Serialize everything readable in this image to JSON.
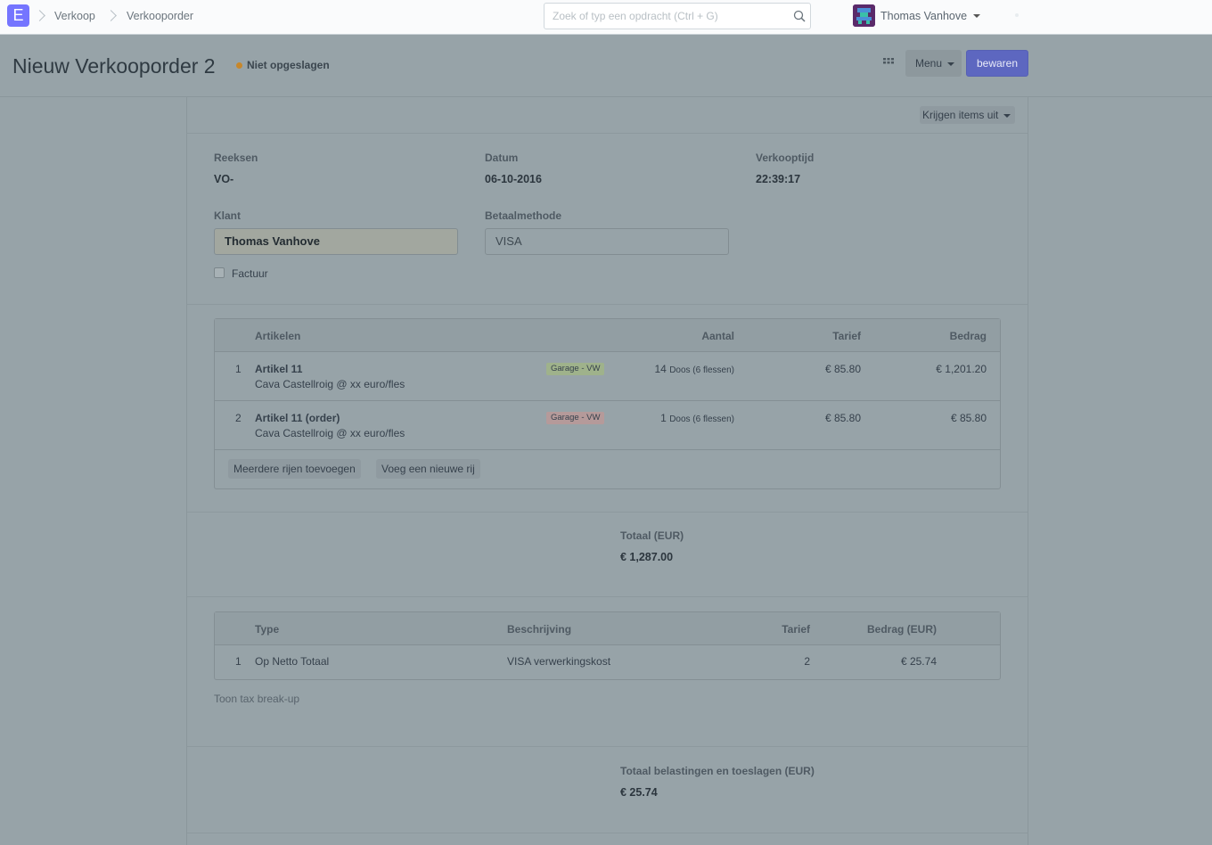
{
  "navbar": {
    "logo_letter": "E",
    "breadcrumbs": [
      "Verkoop",
      "Verkooporder"
    ],
    "search_placeholder": "Zoek of typ een opdracht (Ctrl + G)",
    "user_name": "Thomas Vanhove"
  },
  "page": {
    "title": "Nieuw Verkooporder 2",
    "status": "Niet opgeslagen",
    "menu_label": "Menu",
    "save_label": "bewaren"
  },
  "form": {
    "get_items_label": "Krijgen items uit",
    "fields": {
      "series_label": "Reeksen",
      "series_value": "VO-",
      "date_label": "Datum",
      "date_value": "06-10-2016",
      "time_label": "Verkooptijd",
      "time_value": "22:39:17",
      "customer_label": "Klant",
      "customer_value": "Thomas Vanhove",
      "payment_label": "Betaalmethode",
      "payment_value": "VISA",
      "invoice_label": "Factuur"
    },
    "items_table": {
      "headers": {
        "item": "Artikelen",
        "qty": "Aantal",
        "rate": "Tarief",
        "amount": "Bedrag"
      },
      "rows": [
        {
          "idx": "1",
          "name": "Artikel 11",
          "description": "Cava Castellroig @ xx euro/fles",
          "warehouse": "Garage - VW",
          "warehouse_status": "green",
          "qty": "14",
          "uom": "Doos (6 flessen)",
          "rate": "€ 85.80",
          "amount": "€ 1,201.20"
        },
        {
          "idx": "2",
          "name": "Artikel 11 (order)",
          "description": "Cava Castellroig @ xx euro/fles",
          "warehouse": "Garage - VW",
          "warehouse_status": "red",
          "qty": "1",
          "uom": "Doos (6 flessen)",
          "rate": "€ 85.80",
          "amount": "€ 85.80"
        }
      ],
      "add_multiple_label": "Meerdere rijen toevoegen",
      "add_row_label": "Voeg een nieuwe rij"
    },
    "total": {
      "label": "Totaal (EUR)",
      "value": "€ 1,287.00"
    },
    "taxes_table": {
      "headers": {
        "type": "Type",
        "description": "Beschrijving",
        "rate": "Tarief",
        "amount": "Bedrag (EUR)"
      },
      "rows": [
        {
          "idx": "1",
          "type": "Op Netto Totaal",
          "description": "VISA verwerkingskost",
          "rate": "2",
          "amount": "€ 25.74"
        }
      ],
      "breakup_link": "Toon tax break-up"
    },
    "total_taxes": {
      "label": "Totaal belastingen en toeslagen (EUR)",
      "value": "€ 25.74"
    }
  }
}
